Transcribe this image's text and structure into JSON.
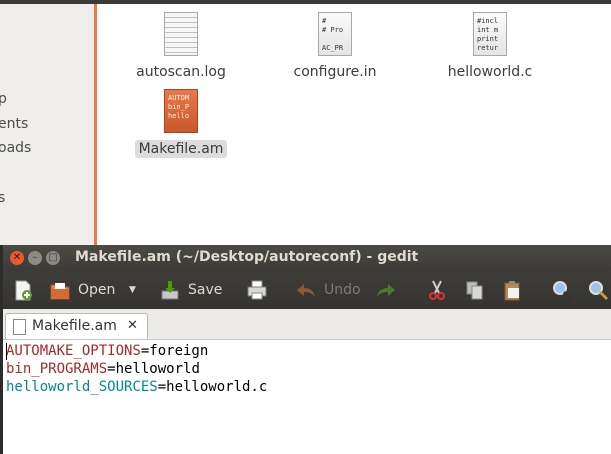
{
  "file_manager": {
    "sidebar_items": [
      "p",
      "ents",
      "oads",
      "s"
    ],
    "files": [
      {
        "name": "autoscan.log",
        "icon": "text-file-icon",
        "snippet": ""
      },
      {
        "name": "configure.in",
        "icon": "text-file-icon",
        "snippet": "#\n# Pro\n\nAC_PR"
      },
      {
        "name": "helloworld.c",
        "icon": "c-source-file-icon",
        "snippet": "#incl\nint m\nprint\nretur"
      },
      {
        "name": "Makefile.am",
        "icon": "makefile-icon",
        "snippet": "AUTOM\nbin_P\nhello",
        "selected": true
      }
    ]
  },
  "gedit": {
    "title": "Makefile.am (~/Desktop/autoreconf) - gedit",
    "toolbar": {
      "open_label": "Open",
      "save_label": "Save",
      "undo_label": "Undo"
    },
    "tab": {
      "label": "Makefile.am",
      "close": "✕"
    },
    "editor": {
      "lines": [
        {
          "key": "AUTOMAKE_OPTIONS",
          "value": "=foreign",
          "color": "#a52a2a"
        },
        {
          "key": "bin_PROGRAMS",
          "value": "=helloworld",
          "color": "#a52a2a"
        },
        {
          "key": "helloworld_SOURCES",
          "value": "=helloworld.c",
          "color": "#008a8c"
        }
      ]
    }
  },
  "colors": {
    "accent_orange": "#f07746",
    "titlebar": "#3b3a36",
    "close_button": "#e95a2b"
  }
}
